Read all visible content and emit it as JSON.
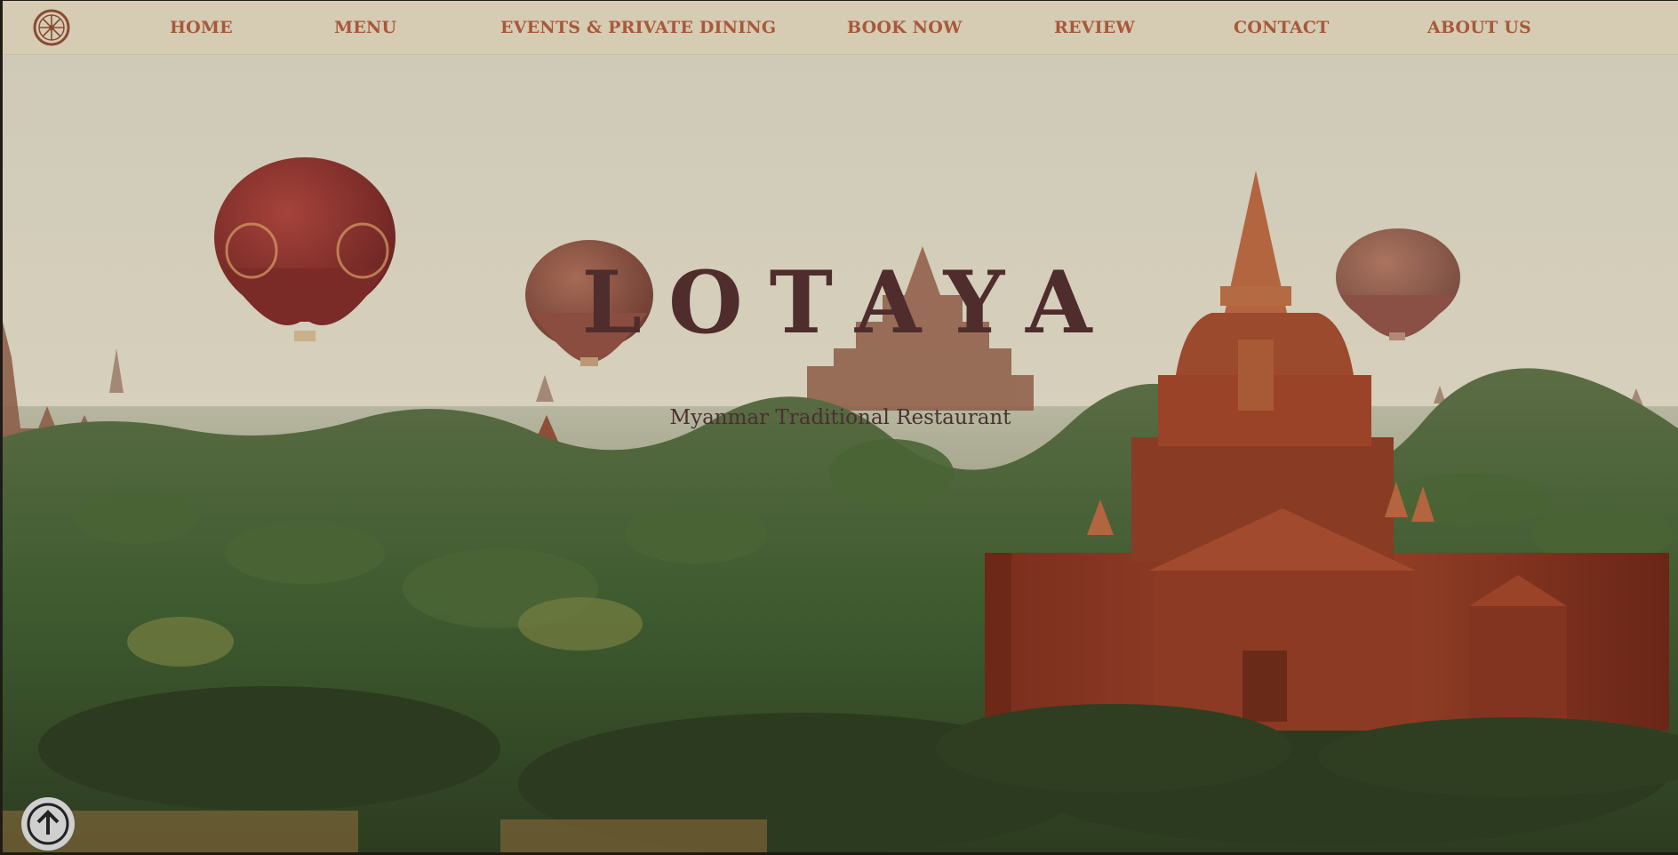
{
  "nav": {
    "logo_icon": "dharma-wheel-icon",
    "items": [
      {
        "label": "HOME"
      },
      {
        "label": "MENU"
      },
      {
        "label": "EVENTS & PRIVATE DINING"
      },
      {
        "label": "BOOK NOW"
      },
      {
        "label": "REVIEW"
      },
      {
        "label": "CONTACT"
      },
      {
        "label": "ABOUT US"
      }
    ]
  },
  "hero": {
    "title": "LOTAYA",
    "subtitle": "Myanmar Traditional Restaurant",
    "background": "bagan-temples-hot-air-balloons-image"
  },
  "scroll_top": {
    "icon": "arrow-up-icon"
  },
  "colors": {
    "nav_background": "#d6cbb3",
    "nav_text": "#a8593a",
    "title_text": "#4f2d2c",
    "subtitle_text": "#4a3030"
  }
}
